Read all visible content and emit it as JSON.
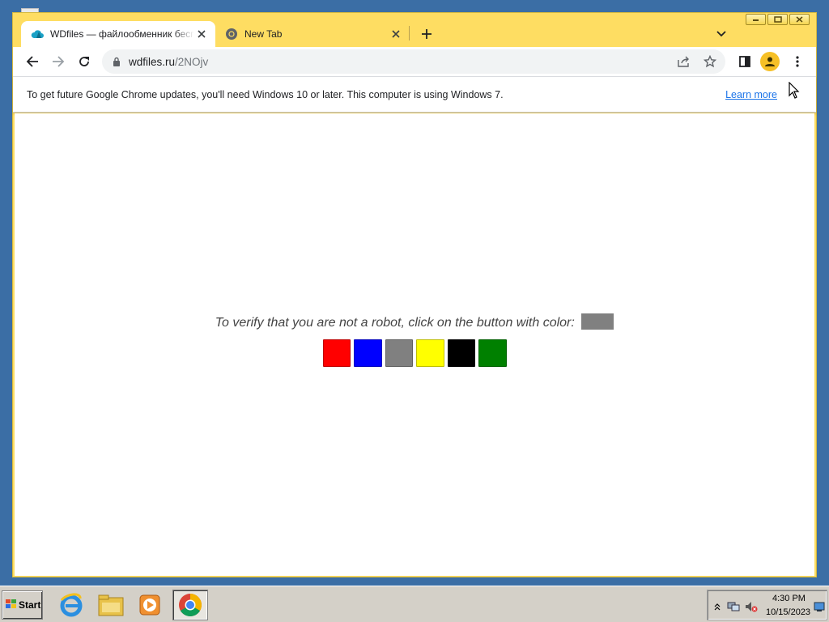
{
  "browser": {
    "tabs": [
      {
        "title": "WDfiles — файлообменник бесплатно",
        "icon": "cloud-icon",
        "active": true
      },
      {
        "title": "New Tab",
        "icon": "chrome-icon",
        "active": false
      }
    ],
    "url": {
      "domain": "wdfiles.ru",
      "path": "/2NOjv"
    },
    "infobar": {
      "message": "To get future Google Chrome updates, you'll need Windows 10 or later. This computer is using Windows 7.",
      "link": "Learn more"
    }
  },
  "page": {
    "prompt": "To verify that you are not a robot, click on the button with color:",
    "target_color": "#808080",
    "color_buttons": [
      {
        "name": "red",
        "color": "#ff0000"
      },
      {
        "name": "blue",
        "color": "#0000ff"
      },
      {
        "name": "gray",
        "color": "#808080"
      },
      {
        "name": "yellow",
        "color": "#ffff00"
      },
      {
        "name": "black",
        "color": "#000000"
      },
      {
        "name": "green",
        "color": "#008000"
      }
    ]
  },
  "taskbar": {
    "start_label": "Start",
    "apps": [
      "internet-explorer-icon",
      "file-explorer-icon",
      "media-player-icon",
      "chrome-icon"
    ],
    "clock": {
      "time": "4:30 PM",
      "date": "10/15/2023"
    }
  },
  "colors": {
    "window_frame": "#fedd62",
    "desktop": "#3b6ea5",
    "link": "#1a73e8"
  }
}
